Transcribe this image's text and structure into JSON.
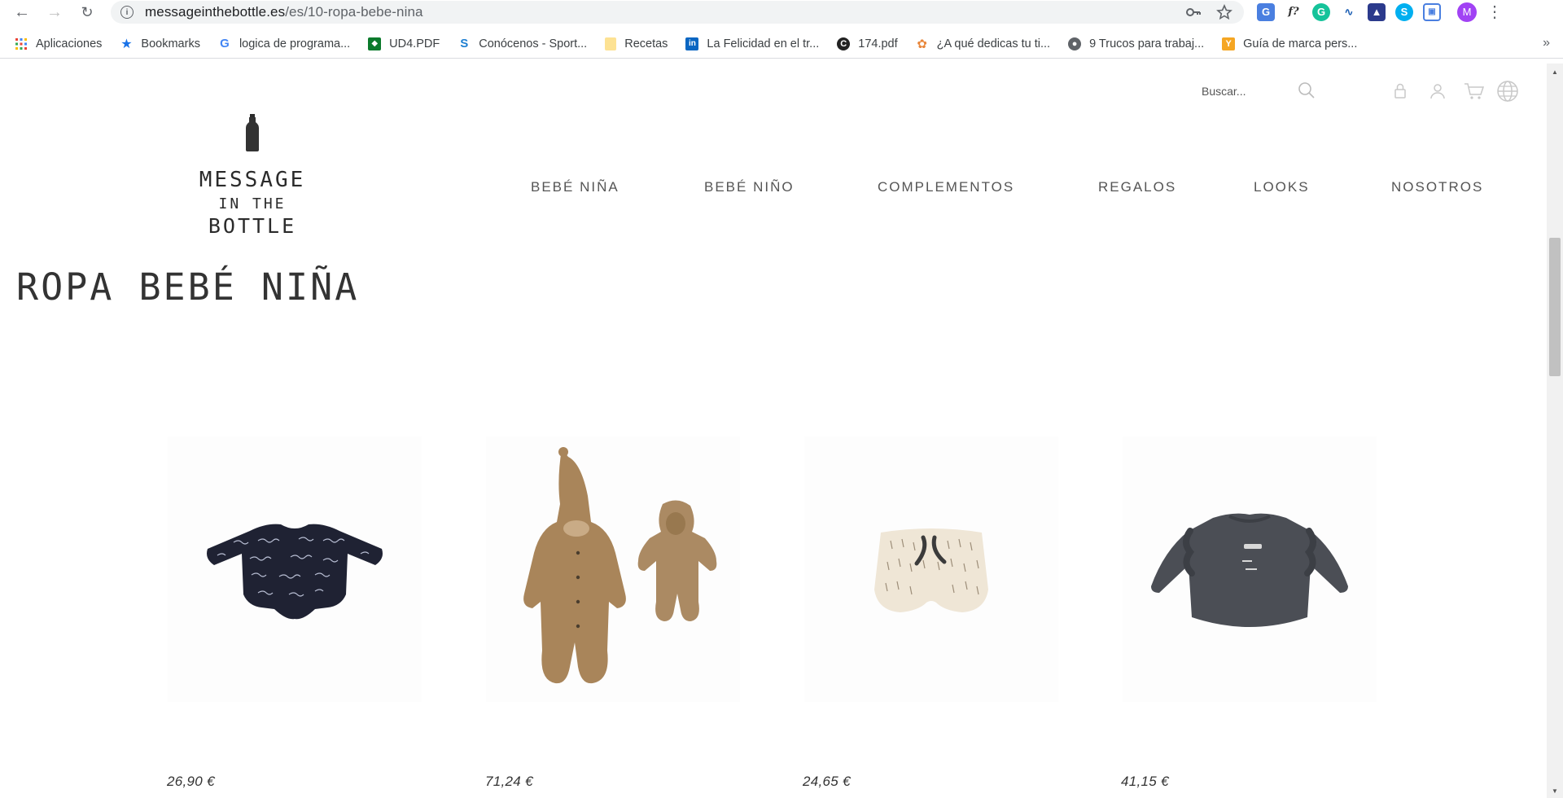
{
  "browser": {
    "url_host": "messageinthebottle.es",
    "url_path": "/es/10-ropa-bebe-nina",
    "profile_initial": "M",
    "bookmarks": [
      {
        "label": "Aplicaciones",
        "icon": "apps-grid-icon"
      },
      {
        "label": "Bookmarks",
        "icon": "star-icon"
      },
      {
        "label": "logica de programa...",
        "icon": "google-icon"
      },
      {
        "label": "UD4.PDF",
        "icon": "junta-andalucia-icon"
      },
      {
        "label": "Conócenos - Sport...",
        "icon": "sport-logo-icon"
      },
      {
        "label": "Recetas",
        "icon": "folder-icon"
      },
      {
        "label": "La Felicidad en el tr...",
        "icon": "linkedin-icon"
      },
      {
        "label": "174.pdf",
        "icon": "pdf-c-icon"
      },
      {
        "label": "¿A qué dedicas tu ti...",
        "icon": "palette-icon"
      },
      {
        "label": "9 Trucos para trabaj...",
        "icon": "globe-icon"
      },
      {
        "label": "Guía de marca pers...",
        "icon": "y-logo-icon"
      }
    ],
    "more_bookmarks": "»"
  },
  "site": {
    "search_placeholder": "Buscar...",
    "logo": {
      "line1": "MESSAGE",
      "line2": "IN THE",
      "line3": "BOTTLE"
    },
    "nav": [
      "BEBÉ NIÑA",
      "BEBÉ NIÑO",
      "COMPLEMENTOS",
      "REGALOS",
      "LOOKS",
      "NOSOTROS"
    ],
    "page_title": "ROPA BEBÉ NIÑA",
    "products": [
      {
        "price": "26,90 €",
        "image": "navy-printed-bodysuit"
      },
      {
        "price": "71,24 €",
        "image": "knitted-hooded-pram-suit"
      },
      {
        "price": "24,65 €",
        "image": "printed-bloomer-shorts"
      },
      {
        "price": "41,15 €",
        "image": "grey-ruffle-sweatshirt"
      }
    ]
  }
}
